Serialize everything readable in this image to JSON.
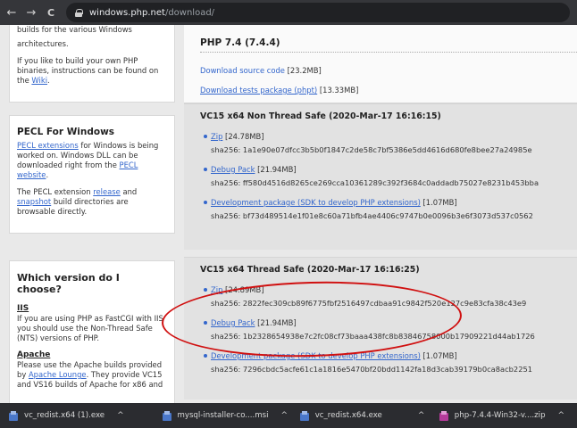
{
  "browser": {
    "url_host": "windows.php.net",
    "url_path": "/download/",
    "nav_back": "←",
    "nav_forward": "→",
    "nav_reload": "C"
  },
  "sidebar": {
    "cut_text": "builds for the various Windows",
    "p1": "architectures.",
    "p2_before": "If you like to build your own PHP binaries, instructions can be found on the ",
    "p2_link": "Wiki",
    "p2_after": ".",
    "pecl_title": "PECL For Windows",
    "pecl_p1_link1": "PECL extensions",
    "pecl_p1_text1": " for Windows is being worked on. Windows DLL can be downloaded right from the ",
    "pecl_p1_link2": "PECL website",
    "pecl_p1_text2": ".",
    "pecl_p2_before": "The PECL extension ",
    "pecl_p2_link1": "release",
    "pecl_p2_mid": " and ",
    "pecl_p2_link2": "snapshot",
    "pecl_p2_after": " build directories are browsable directly.",
    "which_title": "Which version do I choose?",
    "iis_title": "IIS",
    "iis_text": "If you are using PHP as FastCGI with IIS you should use the Non-Thread Safe (NTS) versions of PHP.",
    "apache_title": "Apache",
    "apache_before": "Please use the Apache builds provided by ",
    "apache_link": "Apache Lounge",
    "apache_after": ". They provide VC15 and VS16 builds of Apache for x86 and"
  },
  "main": {
    "version_title": "PHP 7.4 (7.4.4)",
    "source_link": "Download source code",
    "source_size": " [23.2MB]",
    "tests_link": "Download tests package (phpt)",
    "tests_size": " [13.33MB]",
    "builds": [
      {
        "title": "VC15 x64 Non Thread Safe (2020-Mar-17 16:16:15)",
        "items": [
          {
            "link": "Zip",
            "size": " [24.78MB]",
            "sha": "sha256: 1a1e90e07dfcc3b5b0f1847c2de58c7bf5386e5dd4616d680fe8bee27a24985e"
          },
          {
            "link": "Debug Pack",
            "size": " [21.94MB]",
            "sha": "sha256: ff580d4516d8265ce269cca10361289c392f3684c0addadb75027e8231b453bba"
          },
          {
            "link": "Development package (SDK to develop PHP extensions)",
            "size": " [1.07MB]",
            "sha": "sha256: bf73d489514e1f01e8c60a71bfb4ae4406c9747b0e0096b3e6f3073d537c0562"
          }
        ]
      },
      {
        "title": "VC15 x64 Thread Safe (2020-Mar-17 16:16:25)",
        "items": [
          {
            "link": "Zip",
            "size": " [24.89MB]",
            "sha": "sha256: 2822fec309cb89f6775fbf2516497cdbaa91c9842f520e127c9e83cfa38c43e9"
          },
          {
            "link": "Debug Pack",
            "size": " [21.94MB]",
            "sha": "sha256: 1b2328654938e7c2fc08cf73baaa438fc8b83846758000b17909221d44ab1726"
          },
          {
            "link": "Development package (SDK to develop PHP extensions)",
            "size": " [1.07MB]",
            "sha": "sha256: 7296cbdc5acfe61c1a1816e5470bf20bdd1142fa18d3cab39179b0ca8acb2251"
          }
        ]
      }
    ]
  },
  "downloads": [
    {
      "name": "vc_redist.x64 (1).exe",
      "icon": "exe-file-icon"
    },
    {
      "name": "mysql-installer-co....msi",
      "icon": "msi-file-icon"
    },
    {
      "name": "vc_redist.x64.exe",
      "icon": "exe-file-icon"
    },
    {
      "name": "php-7.4.4-Win32-v....zip",
      "icon": "zip-file-icon"
    }
  ],
  "colors": {
    "link": "#3366cc",
    "annotation": "#d01010"
  }
}
